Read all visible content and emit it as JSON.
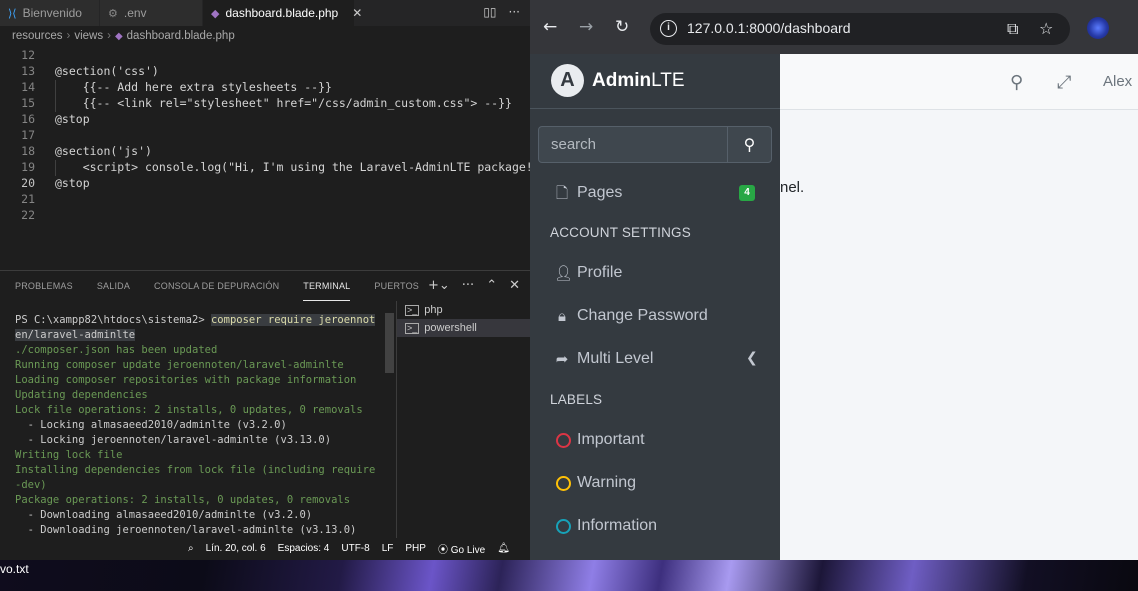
{
  "vscode": {
    "tabs": [
      {
        "label": "Bienvenido",
        "icon": "vscode-icon"
      },
      {
        "label": ".env",
        "icon": "gear-icon"
      },
      {
        "label": "dashboard.blade.php",
        "icon": "php-icon"
      }
    ],
    "breadcrumb": [
      "resources",
      "views",
      "dashboard.blade.php"
    ],
    "code_lines": [
      {
        "n": "12",
        "text": ""
      },
      {
        "n": "13",
        "text": "@section('css')"
      },
      {
        "n": "14",
        "text": "    {{-- Add here extra stylesheets --}}"
      },
      {
        "n": "15",
        "text": "    {{-- <link rel=\"stylesheet\" href=\"/css/admin_custom.css\"> --}}"
      },
      {
        "n": "16",
        "text": "@stop"
      },
      {
        "n": "17",
        "text": ""
      },
      {
        "n": "18",
        "text": "@section('js')"
      },
      {
        "n": "19",
        "text": "    <script> console.log(\"Hi, I'm using the Laravel-AdminLTE package!\"); <"
      },
      {
        "n": "20",
        "text": "@stop"
      },
      {
        "n": "21",
        "text": ""
      },
      {
        "n": "22",
        "text": ""
      }
    ],
    "panel_tabs": [
      "PROBLEMAS",
      "SALIDA",
      "CONSOLA DE DEPURACIÓN",
      "TERMINAL",
      "PUERTOS"
    ],
    "active_panel_tab": "TERMINAL",
    "terminal": {
      "prompt": "PS C:\\xampp82\\htdocs\\sistema2>",
      "command": "composer require jeroennot",
      "command_cont": "en/laravel-adminlte",
      "lines": [
        "./composer.json has been updated",
        "Running composer update jeroennoten/laravel-adminlte",
        "Loading composer repositories with package information",
        "Updating dependencies",
        "Lock file operations: 2 installs, 0 updates, 0 removals",
        "  - Locking almasaeed2010/adminlte (v3.2.0)",
        "  - Locking jeroennoten/laravel-adminlte (v3.13.0)",
        "Writing lock file",
        "Installing dependencies from lock file (including require",
        "-dev)",
        "Package operations: 2 installs, 0 updates, 0 removals",
        "  - Downloading almasaeed2010/adminlte (v3.2.0)",
        "  - Downloading jeroennoten/laravel-adminlte (v3.13.0)"
      ],
      "sessions": [
        "php",
        "powershell"
      ]
    },
    "status": {
      "position": "Lín. 20, col. 6",
      "spaces": "Espacios: 4",
      "encoding": "UTF-8",
      "eol": "LF",
      "language": "PHP",
      "live": "Go Live"
    }
  },
  "desktop": {
    "file_label": "vo.txt"
  },
  "browser": {
    "url": "127.0.0.1:8000/dashboard",
    "brand": {
      "bold": "Admin",
      "light": "LTE"
    },
    "search_placeholder": "search",
    "menu": {
      "pages": {
        "label": "Pages",
        "badge": "4"
      },
      "account_header": "ACCOUNT SETTINGS",
      "profile": "Profile",
      "change_password": "Change Password",
      "multi_level": "Multi Level",
      "labels_header": "LABELS",
      "important": "Important",
      "warning": "Warning",
      "information": "Information"
    },
    "label_colors": {
      "important": "#dc3545",
      "warning": "#ffc107",
      "information": "#17a2b8"
    },
    "accent": "#28a745",
    "user": "Alex",
    "content_text": "nel."
  }
}
